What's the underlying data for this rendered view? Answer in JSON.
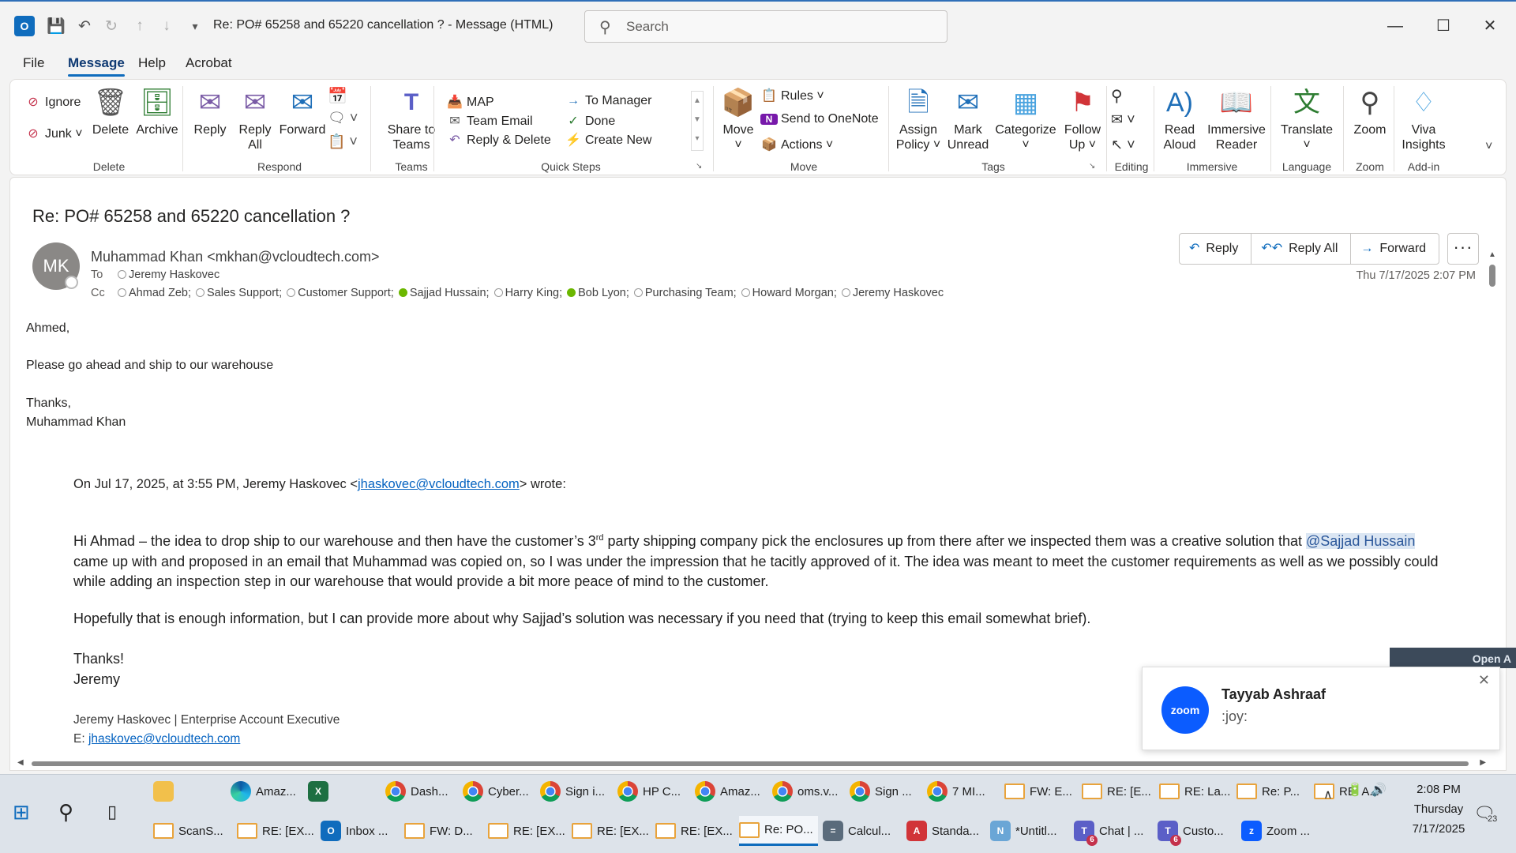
{
  "window": {
    "title": "Re: PO# 65258 and 65220 cancellation ?  -  Message (HTML)",
    "search_placeholder": "Search"
  },
  "menu_tabs": [
    "File",
    "Message",
    "Help",
    "Acrobat"
  ],
  "ribbon": {
    "delete_group": {
      "label": "Delete",
      "ignore": "Ignore",
      "junk": "Junk",
      "delete": "Delete",
      "archive": "Archive"
    },
    "respond_group": {
      "label": "Respond",
      "reply": "Reply",
      "reply_all_1": "Reply",
      "reply_all_2": "All",
      "forward": "Forward"
    },
    "teams_group": {
      "label": "Teams",
      "share_1": "Share to",
      "share_2": "Teams"
    },
    "quick_steps": {
      "label": "Quick Steps",
      "items": [
        "MAP",
        "Team Email",
        "Reply & Delete",
        "To Manager",
        "Done",
        "Create New"
      ]
    },
    "move_group": {
      "label": "Move",
      "move": "Move",
      "rules": "Rules",
      "onenote": "Send to OneNote",
      "actions": "Actions"
    },
    "tags_group": {
      "label": "Tags",
      "assign_1": "Assign",
      "assign_2": "Policy",
      "mark_1": "Mark",
      "mark_2": "Unread",
      "categorize": "Categorize",
      "follow_1": "Follow",
      "follow_2": "Up"
    },
    "editing_group": {
      "label": "Editing"
    },
    "immersive_group": {
      "label": "Immersive",
      "read_1": "Read",
      "read_2": "Aloud",
      "imm_1": "Immersive",
      "imm_2": "Reader"
    },
    "language_group": {
      "label": "Language",
      "translate": "Translate"
    },
    "zoom_group": {
      "label": "Zoom",
      "zoom": "Zoom"
    },
    "addin_group": {
      "label": "Add-in",
      "viva_1": "Viva",
      "viva_2": "Insights"
    }
  },
  "message": {
    "subject": "Re: PO# 65258 and 65220 cancellation ?",
    "avatar_initials": "MK",
    "sender": "Muhammad Khan <mkhan@vcloudtech.com>",
    "to_label": "To",
    "to": "Jeremy Haskovec",
    "cc_label": "Cc",
    "cc": [
      {
        "name": "Ahmad Zeb;",
        "online": false
      },
      {
        "name": "Sales Support;",
        "online": false
      },
      {
        "name": "Customer Support;",
        "online": false
      },
      {
        "name": "Sajjad Hussain;",
        "online": true
      },
      {
        "name": "Harry King;",
        "online": false
      },
      {
        "name": "Bob Lyon;",
        "online": true
      },
      {
        "name": "Purchasing Team;",
        "online": false
      },
      {
        "name": "Howard Morgan;",
        "online": false
      },
      {
        "name": "Jeremy Haskovec",
        "online": false
      }
    ],
    "actions": {
      "reply": "Reply",
      "reply_all": "Reply All",
      "forward": "Forward",
      "more": "···"
    },
    "date": "Thu 7/17/2025 2:07 PM",
    "body": {
      "greeting": "Ahmed,",
      "line1": "Please go ahead and ship to our warehouse",
      "thanks": "Thanks,",
      "name": "Muhammad Khan"
    },
    "quoted": {
      "header_pre": "On Jul 17, 2025, at 3:55 PM, Jeremy Haskovec <",
      "header_email": "jhaskovec@vcloudtech.com",
      "header_post": "> wrote:",
      "p1_a": "Hi Ahmad – the idea to drop ship to our warehouse and then have the customer’s 3",
      "p1_sup": "rd",
      "p1_b": " party shipping company pick the enclosures up from there after we inspected them was a creative solution that ",
      "p1_mention": "@Sajjad Hussain",
      "p1_c": " came up with and proposed in an email that Muhammad was copied on, so I was under the impression that he tacitly approved of it.  The idea was meant to meet the customer requirements as well as we possibly could while adding an inspection step in our warehouse that would provide a bit more peace of mind to the customer.",
      "p2": "Hopefully that is enough information, but I can provide more about why Sajjad’s solution was necessary if you need that (trying to keep this email somewhat brief).",
      "thanks": "Thanks!",
      "name": "Jeremy",
      "sig_title": "Jeremy Haskovec | Enterprise Account Executive",
      "sig_e_label": "E: ",
      "sig_email": "jhaskovec@vcloudtech.com"
    }
  },
  "toast": {
    "app": "zoom",
    "name": "Tayyab Ashraaf",
    "message": ":joy:",
    "open_label": "Open A"
  },
  "taskbar": {
    "row1": [
      {
        "label": "",
        "icon": "file-explorer"
      },
      {
        "label": "Amaz...",
        "icon": "edge"
      },
      {
        "label": "",
        "icon": "excel"
      },
      {
        "label": "Dash...",
        "icon": "chrome"
      },
      {
        "label": "Cyber...",
        "icon": "chrome"
      },
      {
        "label": "Sign i...",
        "icon": "chrome"
      },
      {
        "label": "HP C...",
        "icon": "chrome"
      },
      {
        "label": "Amaz...",
        "icon": "chrome"
      },
      {
        "label": "oms.v...",
        "icon": "chrome"
      },
      {
        "label": "Sign ...",
        "icon": "chrome"
      },
      {
        "label": "7 MI...",
        "icon": "chrome"
      },
      {
        "label": "FW: E...",
        "icon": "mail"
      },
      {
        "label": "RE: [E...",
        "icon": "mail"
      },
      {
        "label": "RE: La...",
        "icon": "mail"
      },
      {
        "label": "Re: P...",
        "icon": "mail"
      },
      {
        "label": "RE: A...",
        "icon": "mail"
      }
    ],
    "row2": [
      {
        "label": "ScanS...",
        "icon": "mail"
      },
      {
        "label": "RE: [EX...",
        "icon": "mail"
      },
      {
        "label": "Inbox ...",
        "icon": "outlook"
      },
      {
        "label": "FW: D...",
        "icon": "mail"
      },
      {
        "label": "RE: [EX...",
        "icon": "mail"
      },
      {
        "label": "RE: [EX...",
        "icon": "mail"
      },
      {
        "label": "RE: [EX...",
        "icon": "mail"
      },
      {
        "label": "Re: PO...",
        "icon": "mail"
      },
      {
        "label": "Calcul...",
        "icon": "calculator"
      },
      {
        "label": "Standa...",
        "icon": "pdf"
      },
      {
        "label": "*Untitl...",
        "icon": "notepad"
      },
      {
        "label": "Chat | ...",
        "icon": "teams",
        "badge": "6"
      },
      {
        "label": "Custo...",
        "icon": "teams",
        "badge": "6"
      },
      {
        "label": "Zoom ...",
        "icon": "zoom"
      }
    ],
    "time": "2:08 PM",
    "day": "Thursday",
    "date": "7/17/2025",
    "notif_count": "23"
  }
}
